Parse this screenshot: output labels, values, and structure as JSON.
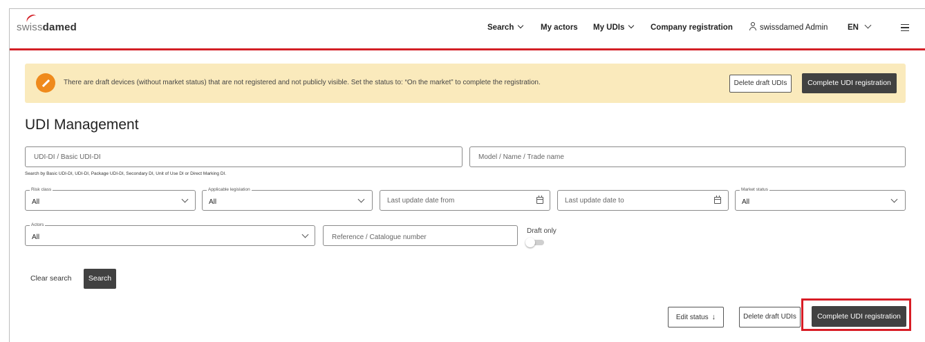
{
  "header": {
    "logo_thin": "swiss",
    "logo_bold": "damed",
    "nav": [
      {
        "label": "Search",
        "dropdown": true
      },
      {
        "label": "My actors",
        "dropdown": false
      },
      {
        "label": "My UDIs",
        "dropdown": true
      },
      {
        "label": "Company registration",
        "dropdown": false
      }
    ],
    "user_name": "swissdamed Admin",
    "language": "EN",
    "accent_color": "#d31f26"
  },
  "alert": {
    "message": "There are draft devices (without market status) that are not registered and not publicly visible. Set the status to: “On the market” to complete the registration.",
    "delete_label": "Delete draft UDIs",
    "complete_label": "Complete UDI registration",
    "background_color": "#faeabc",
    "icon_color": "#ef8a1c"
  },
  "page_title": "UDI Management",
  "filters": {
    "udi_placeholder": "UDI-DI / Basic UDI-DI",
    "model_placeholder": "Model / Name / Trade name",
    "udi_hint": "Search by Basic UDI-DI, UDI-DI, Package UDI-DI, Secondary DI, Unit of Use DI or Direct Marking DI.",
    "risk_class_label": "Risk class",
    "risk_class_value": "All",
    "legislation_label": "Applicable legislation",
    "legislation_value": "All",
    "date_from_placeholder": "Last update date from",
    "date_to_placeholder": "Last update date to",
    "market_status_label": "Market status",
    "market_status_value": "All",
    "actors_label": "Actors",
    "actors_value": "All",
    "reference_placeholder": "Reference / Catalogue number",
    "draft_only_label": "Draft only",
    "draft_only_checked": false
  },
  "actions": {
    "clear_label": "Clear search",
    "search_label": "Search"
  },
  "footer_actions": {
    "edit_status_label": "Edit status",
    "delete_label": "Delete draft UDIs",
    "complete_label": "Complete UDI registration",
    "highlight_color": "#d81c25"
  }
}
